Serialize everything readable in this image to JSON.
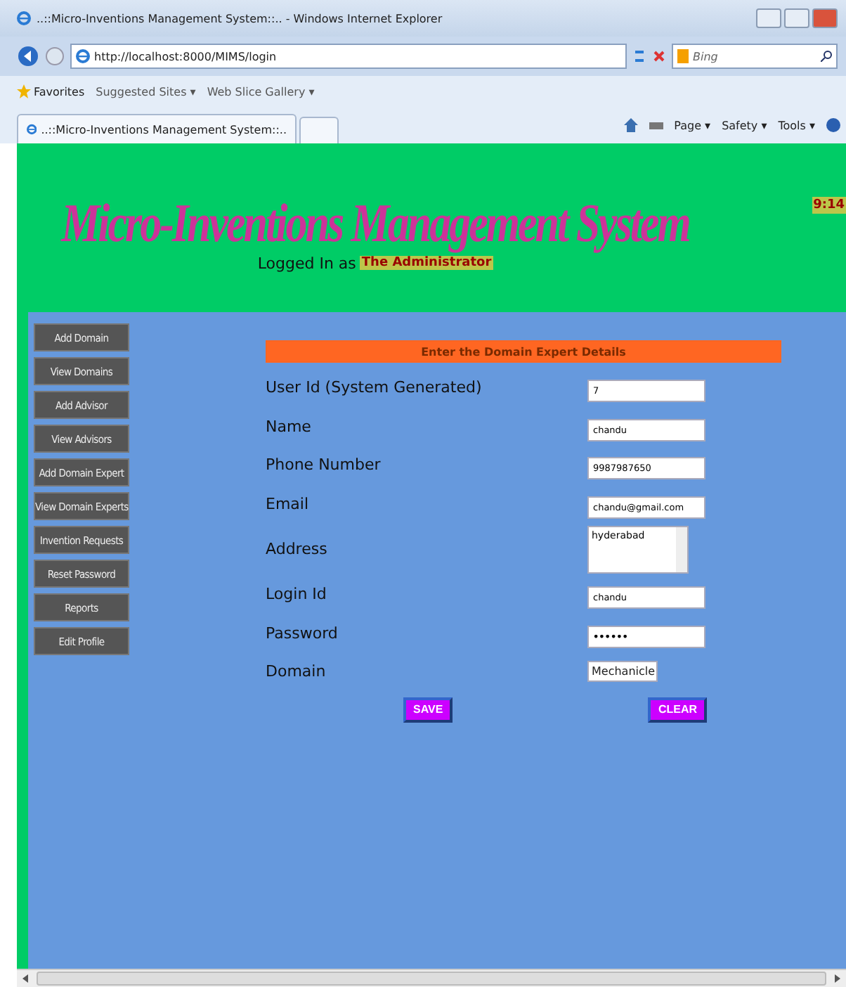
{
  "browser": {
    "title": "..::Micro-Inventions Management System::.. - Windows Internet Explorer",
    "address": "http://localhost:8000/MIMS/login",
    "search_placeholder": "Bing",
    "favorites": "Favorites",
    "links": [
      "Suggested Sites ▾",
      "Web Slice Gallery ▾"
    ],
    "tab": "..::Micro-Inventions Management System::..",
    "commands": [
      "Page ▾",
      "Safety ▾",
      "Tools ▾"
    ]
  },
  "header": {
    "title": "Micro-Inventions Management System",
    "logged_in": "Logged In as",
    "user": "The Administrator",
    "time": "9:14"
  },
  "menu": [
    "Add Domain",
    "View Domains",
    "Add Advisor",
    "View Advisors",
    "Add Domain Expert",
    "View Domain Experts",
    "Invention Requests",
    "Reset Password",
    "Reports",
    "Edit Profile"
  ],
  "form": {
    "heading": "Enter the Domain Expert Details",
    "fields": [
      {
        "label": "User Id (System Generated)",
        "kind": "text",
        "value": "7"
      },
      {
        "label": "Name",
        "kind": "text",
        "value": "chandu"
      },
      {
        "label": "Phone Number",
        "kind": "text",
        "value": "9987987650"
      },
      {
        "label": "Email",
        "kind": "text",
        "value": "chandu@gmail.com"
      },
      {
        "label": "Address",
        "kind": "textarea",
        "value": "hyderabad"
      },
      {
        "label": "Login Id",
        "kind": "text",
        "value": "chandu"
      },
      {
        "label": "Password",
        "kind": "password",
        "value": "••••••"
      },
      {
        "label": "Domain",
        "kind": "select",
        "value": "Mechanicle"
      }
    ],
    "buttons": [
      "SAVE",
      "CLEAR"
    ]
  }
}
